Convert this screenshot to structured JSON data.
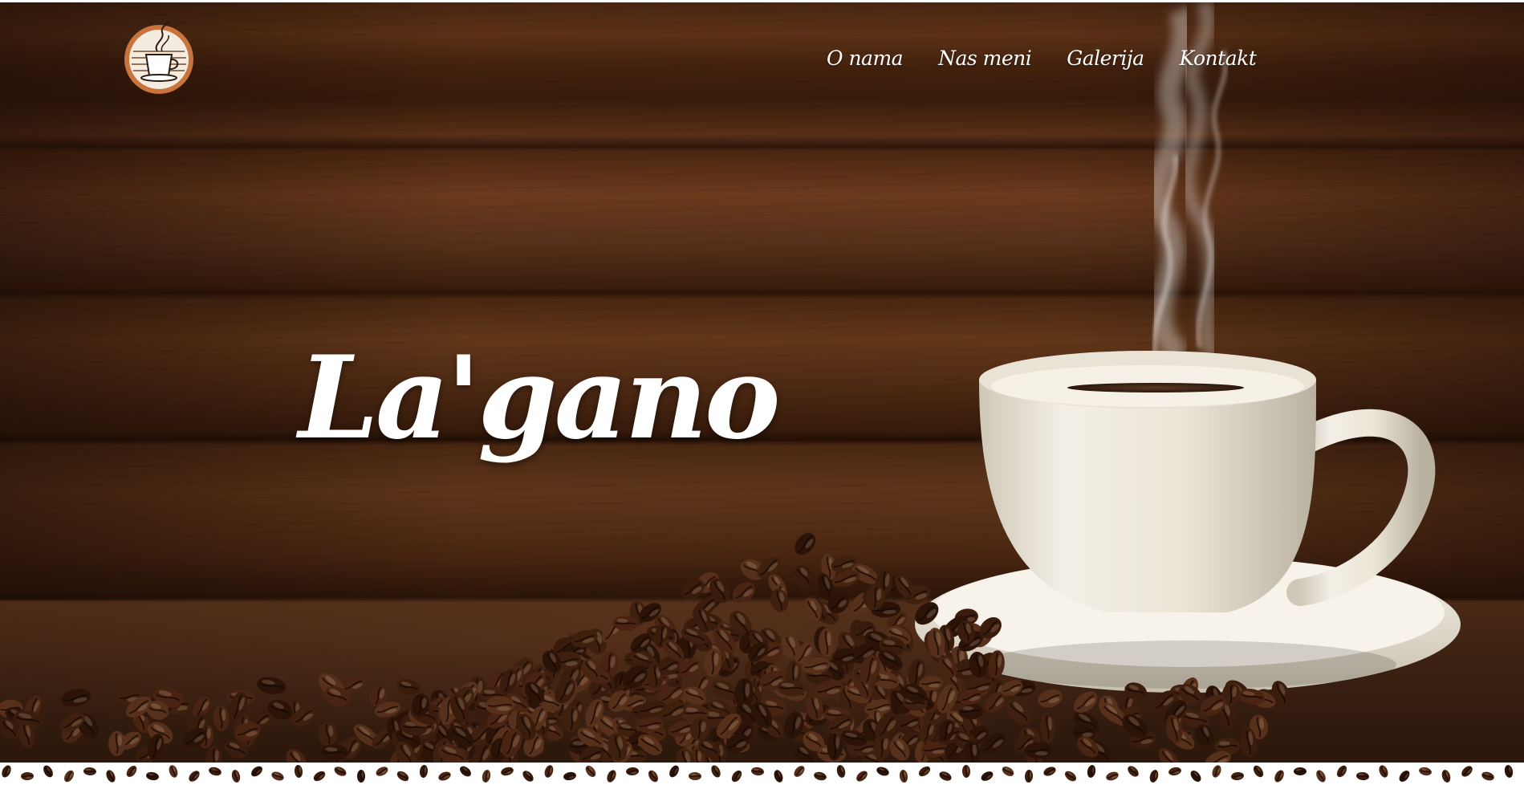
{
  "header": {
    "logo_icon": "coffee-cup-logo-icon",
    "nav": [
      {
        "label": "O nama"
      },
      {
        "label": "Nas meni"
      },
      {
        "label": "Galerija"
      },
      {
        "label": "Kontakt"
      }
    ]
  },
  "hero": {
    "title": "La'gano",
    "background": "coffee cup with beans on wooden table"
  },
  "footer_border": {
    "pattern_icon": "coffee-bean-icon"
  },
  "colors": {
    "wood_dark": "#3b1d0b",
    "wood_mid": "#6e3b1b",
    "logo_ring": "#c8743c",
    "text": "#ffffff"
  }
}
